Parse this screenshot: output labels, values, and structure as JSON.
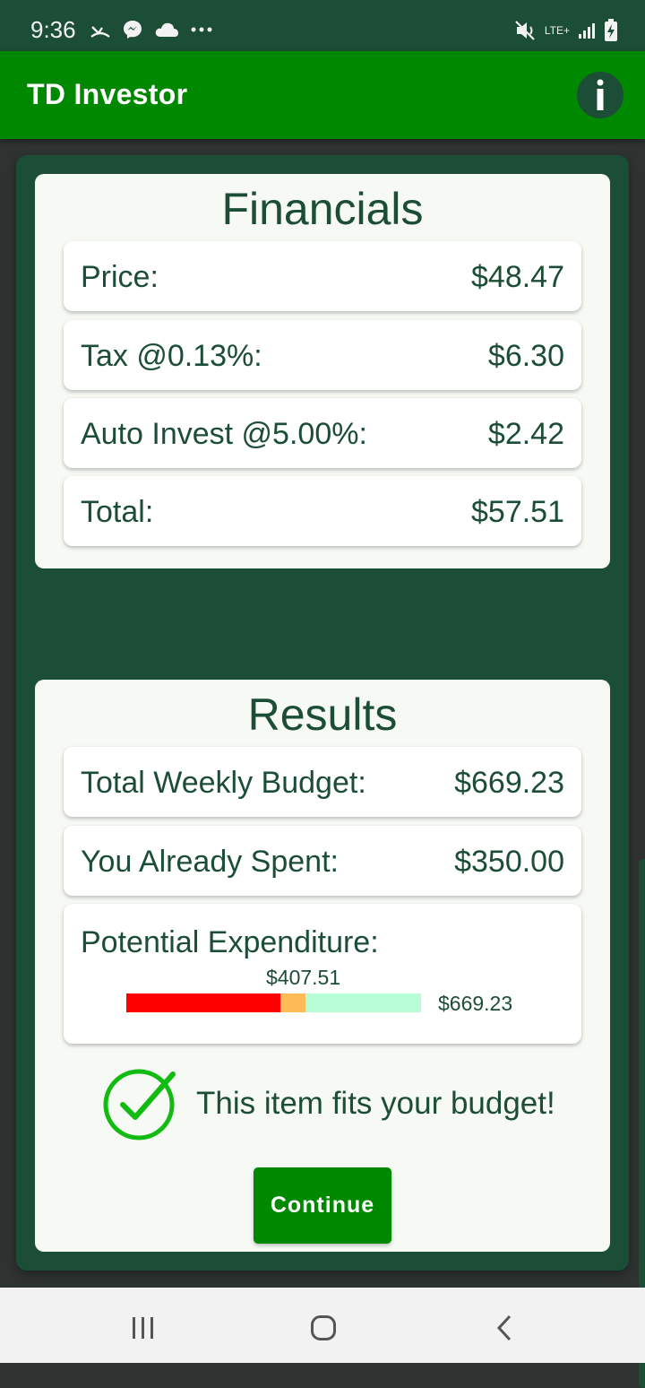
{
  "status_bar": {
    "time": "9:36",
    "network_label": "LTE+",
    "icons": [
      "missed-call-icon",
      "messenger-icon",
      "cloud-icon",
      "more-dots-icon",
      "mute-icon",
      "signal-icon",
      "battery-charging-icon"
    ]
  },
  "app_bar": {
    "title": "TD Investor",
    "info_icon": "info-icon"
  },
  "financials": {
    "title": "Financials",
    "rows": [
      {
        "label": "Price:",
        "value": "$48.47"
      },
      {
        "label": "Tax @0.13%:",
        "value": "$6.30"
      },
      {
        "label": "Auto Invest @5.00%:",
        "value": "$2.42"
      },
      {
        "label": "Total:",
        "value": "$57.51"
      }
    ]
  },
  "results": {
    "title": "Results",
    "rows": [
      {
        "label": "Total Weekly Budget:",
        "value": "$669.23"
      },
      {
        "label": "You Already Spent:",
        "value": "$350.00"
      }
    ],
    "expenditure": {
      "label": "Potential Expenditure:",
      "bar_value_label": "$407.51",
      "bar_max_label": "$669.23",
      "spent_fraction": 0.523,
      "item_fraction": 0.086,
      "spent_color": "#ff0000",
      "item_color": "#ffbb55",
      "remaining_color": "#b7fdd6"
    },
    "fit_message": "This item fits your budget!",
    "check_icon": "check-circle-icon",
    "continue_label": "Continue"
  },
  "nav_bar": {
    "icons": [
      "recents-icon",
      "home-icon",
      "back-icon"
    ]
  },
  "colors": {
    "app_bar": "#008800",
    "status_bar": "#1c4d36",
    "text": "#1c4d36",
    "check": "#11bb11"
  }
}
